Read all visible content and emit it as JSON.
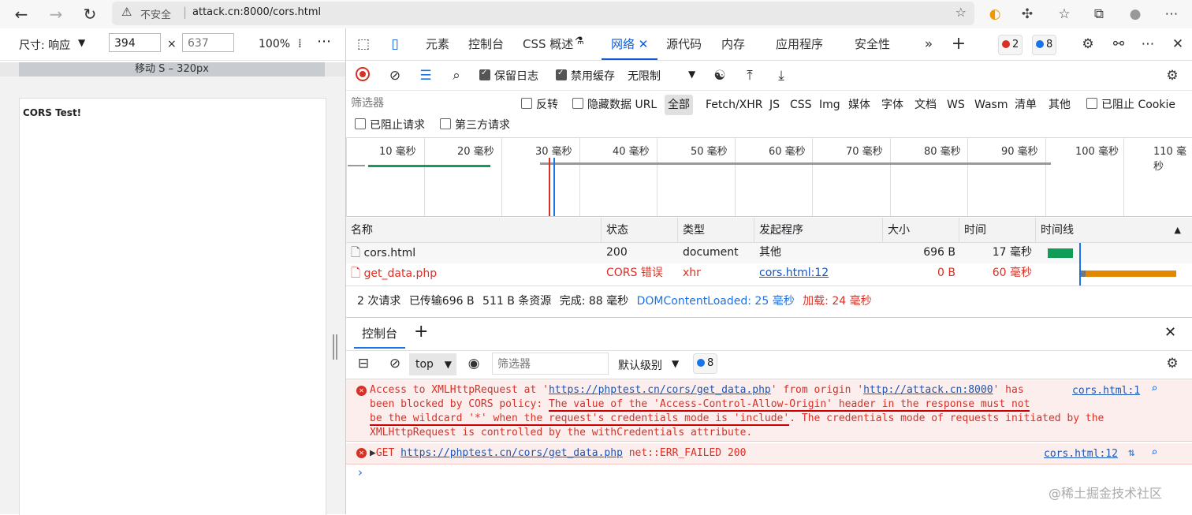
{
  "browser": {
    "back": "←",
    "forward": "→",
    "reload": "↻",
    "insecure_label": "不安全",
    "url": "attack.cn:8000/cors.html"
  },
  "device": {
    "size_label": "尺寸: 响应",
    "width": "394",
    "height_placeholder": "637",
    "times": "×",
    "zoom": "100%",
    "ruler_label": "移动 S – 320px",
    "page_heading": "CORS Test!"
  },
  "devtools": {
    "tabs": [
      "元素",
      "控制台",
      "CSS 概述",
      "网络",
      "源代码",
      "内存",
      "应用程序",
      "安全性"
    ],
    "error_count": "2",
    "message_count": "8",
    "net_toolbar": {
      "preserve_log": "保留日志",
      "disable_cache": "禁用缓存",
      "throttle": "无限制"
    },
    "filter": {
      "placeholder": "筛选器",
      "invert": "反转",
      "hide_data_url": "隐藏数据 URL",
      "types": [
        "全部",
        "Fetch/XHR",
        "JS",
        "CSS",
        "Img",
        "媒体",
        "字体",
        "文档",
        "WS",
        "Wasm",
        "清单",
        "其他"
      ],
      "blocked_cookies": "已阻止 Cookie",
      "blocked_requests": "已阻止请求",
      "third_party": "第三方请求"
    },
    "overview_ticks": [
      "10 毫秒",
      "20 毫秒",
      "30 毫秒",
      "40 毫秒",
      "50 毫秒",
      "60 毫秒",
      "70 毫秒",
      "80 毫秒",
      "90 毫秒",
      "100 毫秒",
      "110 毫秒"
    ],
    "table": {
      "headers": [
        "名称",
        "状态",
        "类型",
        "发起程序",
        "大小",
        "时间",
        "时间线"
      ],
      "rows": [
        {
          "name": "cors.html",
          "status": "200",
          "type": "document",
          "initiator": "其他",
          "size": "696 B",
          "time": "17 毫秒"
        },
        {
          "name": "get_data.php",
          "status": "CORS 错误",
          "type": "xhr",
          "initiator": "cors.html:12",
          "size": "0 B",
          "time": "60 毫秒"
        }
      ]
    },
    "summary": {
      "requests": "2 次请求",
      "transferred": "已传输696 B",
      "resources": "511 B 条资源",
      "finish": "完成: 88 毫秒",
      "dcl": "DOMContentLoaded: 25 毫秒",
      "load": "加载: 24 毫秒"
    },
    "console": {
      "tab": "控制台",
      "context": "top",
      "filter_placeholder": "筛选器",
      "levels": "默认级别",
      "msg_count": "8",
      "error1": {
        "p1": "Access to XMLHttpRequest at '",
        "url1": "https://phptest.cn/cors/get_data.php",
        "p2": "' from origin '",
        "url2": "http://attack.cn:8000",
        "p3": "' has",
        "p4": "been blocked by CORS policy: ",
        "u1": "The value of the 'Access-Control-Allow-Origin' header in the response must not",
        "u2": "be the wildcard '*' when the request's credentials mode is 'include'",
        "p5": ". The credentials mode of requests initiated by the",
        "p6": "XMLHttpRequest is controlled by the withCredentials attribute.",
        "source": "cors.html:1"
      },
      "error2": {
        "method": "GET ",
        "url": "https://phptest.cn/cors/get_data.php",
        "rest": " net::ERR_FAILED 200",
        "source": "cors.html:12"
      },
      "prompt": "›"
    },
    "watermark": "@稀土掘金技术社区"
  }
}
